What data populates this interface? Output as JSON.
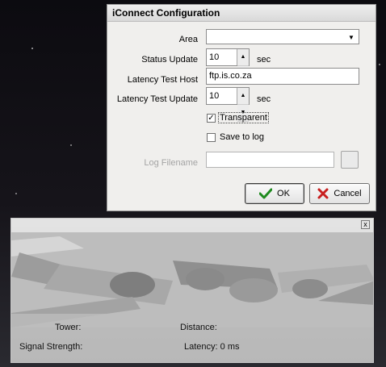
{
  "dialog": {
    "title": "iConnect Configuration",
    "area": {
      "label": "Area",
      "value": ""
    },
    "status_update": {
      "label": "Status Update",
      "value": "10",
      "unit": "sec"
    },
    "latency_host": {
      "label": "Latency Test Host",
      "value": "ftp.is.co.za"
    },
    "latency_update": {
      "label": "Latency Test Update",
      "value": "10",
      "unit": "sec"
    },
    "transparent": {
      "label": "Transparent",
      "checked": true
    },
    "save_to_log": {
      "label": "Save to log",
      "checked": false
    },
    "log_filename": {
      "label": "Log Filename",
      "value": ""
    },
    "ok_label": "OK",
    "cancel_label": "Cancel",
    "icons": {
      "ok": "checkmark-icon",
      "cancel": "x-icon"
    }
  },
  "panel": {
    "close_glyph": "x",
    "tower_label": "Tower:",
    "distance_label": "Distance:",
    "signal_label": "Signal Strength:",
    "latency_text": "Latency: 0 ms"
  },
  "colors": {
    "ok_green": "#1e8a1e",
    "cancel_red": "#c81e1e",
    "desktop": "#0a0a0d"
  }
}
